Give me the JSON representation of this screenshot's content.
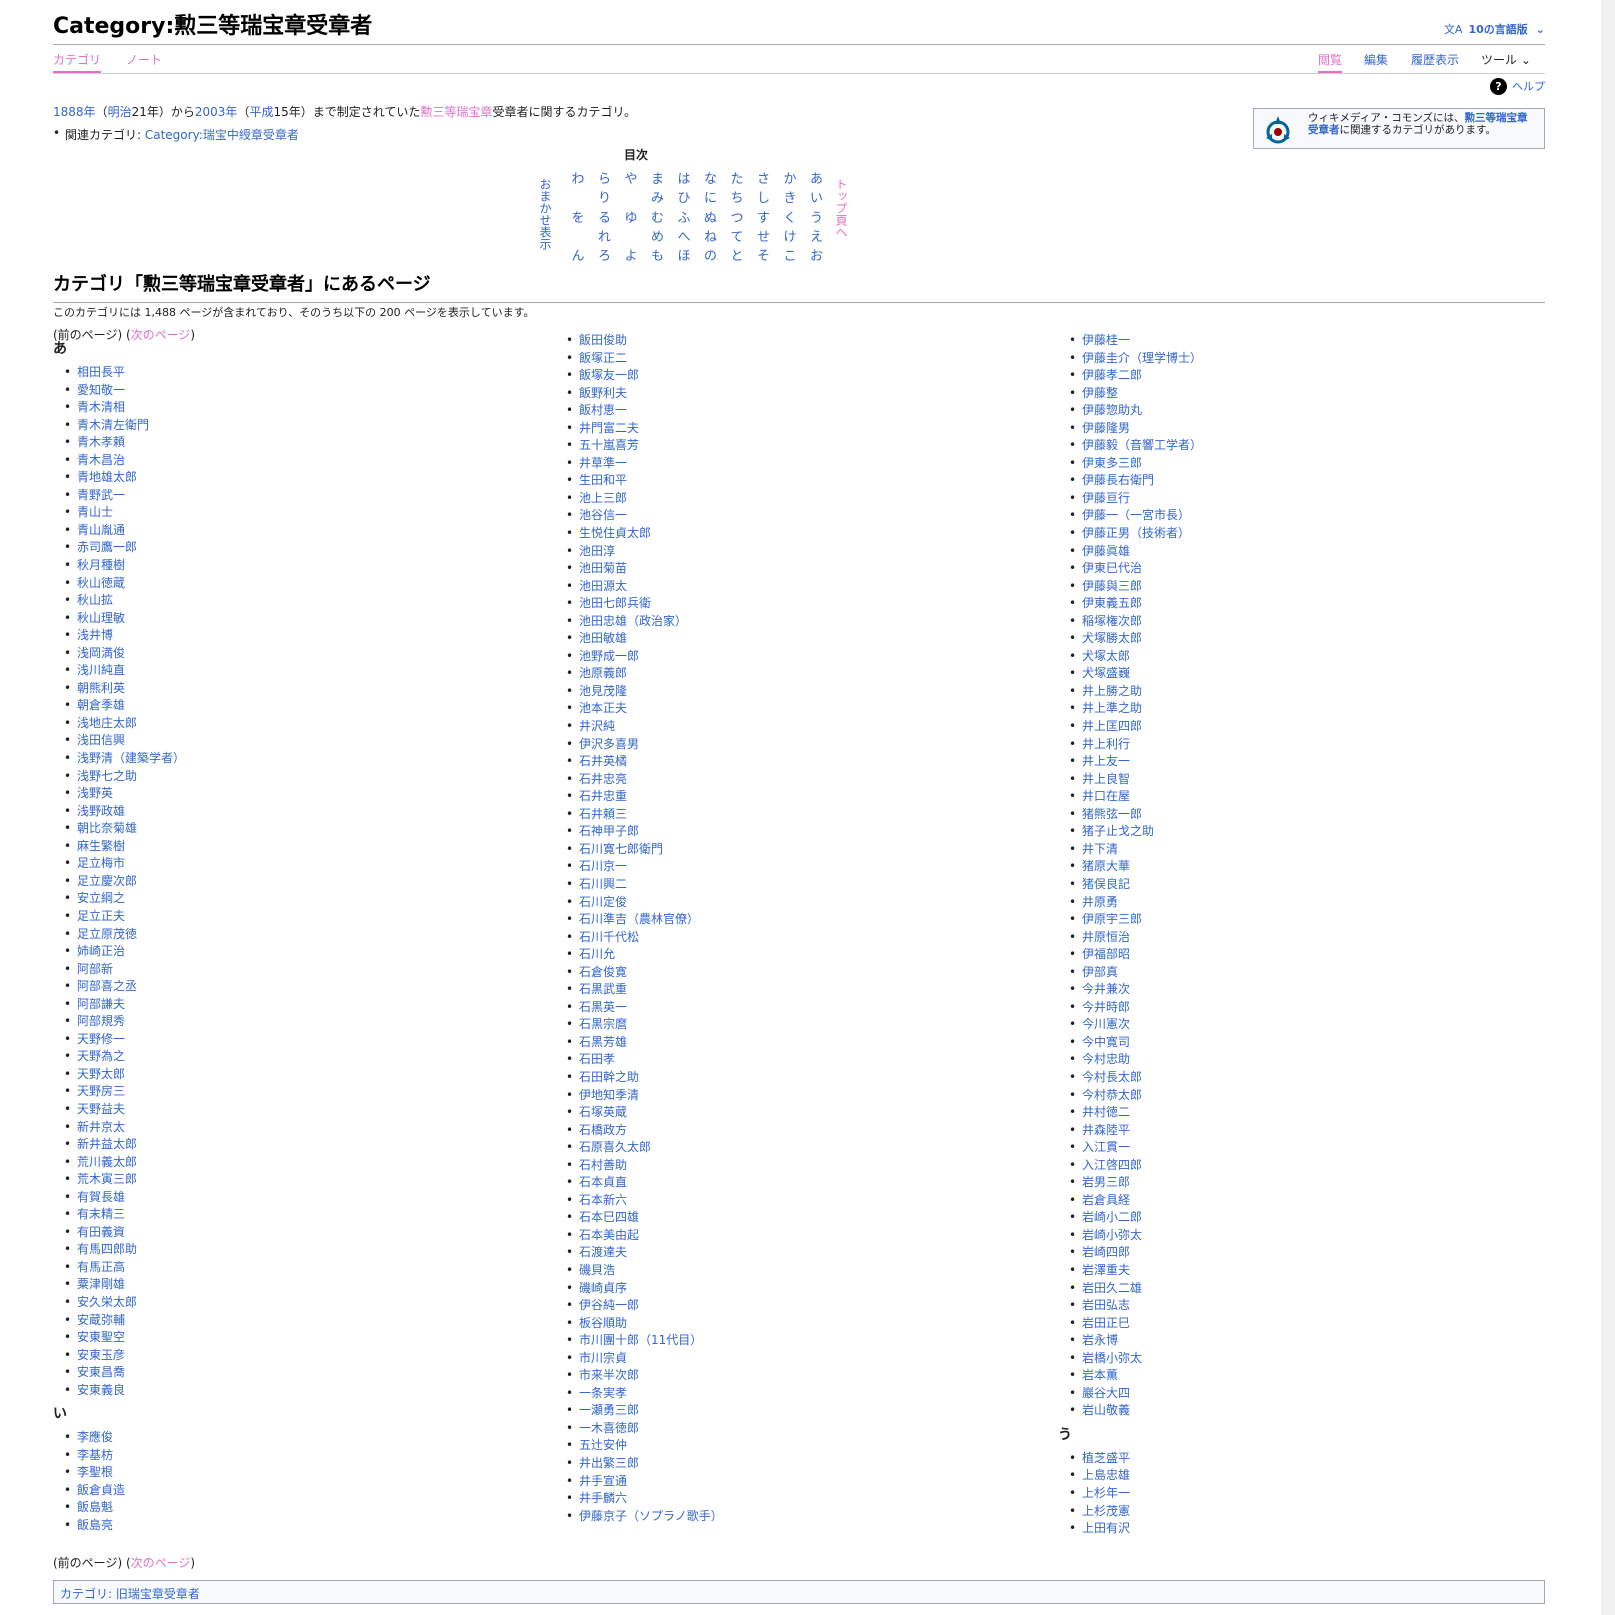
{
  "header": {
    "title": "Category:勲三等瑞宝章受章者",
    "lang_icon": "文A",
    "lang_label": "10の言語版",
    "tabs": {
      "category": "カテゴリ",
      "talk": "ノート",
      "read": "閲覧",
      "edit": "編集",
      "history": "履歴表示",
      "tools": "ツール"
    },
    "help": "ヘルプ"
  },
  "intro": {
    "year1": "1888年",
    "era1a": "明治",
    "era1b": "21年",
    "from": "から",
    "year2": "2003年",
    "era2a": "平成",
    "era2b": "15年",
    "mid": "まで制定されていた",
    "award": "勲三等瑞宝章",
    "tail": "受章者に関するカテゴリ。",
    "related_label": "関連カテゴリ: ",
    "related_link": "Category:瑞宝中綬章受章者",
    "open_paren": "（",
    "close_paren": "）"
  },
  "commons": {
    "pre": "ウィキメディア・コモンズには、",
    "link": "勲三等瑞宝章受章者",
    "post": "に関連するカテゴリがあります。"
  },
  "toc": {
    "title": "目次",
    "random": "おまかせ表示",
    "top": "トップ頁へ",
    "columns": [
      [
        "わ",
        "",
        "を",
        "",
        "ん"
      ],
      [
        "ら",
        "り",
        "る",
        "れ",
        "ろ"
      ],
      [
        "や",
        "",
        "ゆ",
        "",
        "よ"
      ],
      [
        "ま",
        "み",
        "む",
        "め",
        "も"
      ],
      [
        "は",
        "ひ",
        "ふ",
        "へ",
        "ほ"
      ],
      [
        "な",
        "に",
        "ぬ",
        "ね",
        "の"
      ],
      [
        "た",
        "ち",
        "つ",
        "て",
        "と"
      ],
      [
        "さ",
        "し",
        "す",
        "せ",
        "そ"
      ],
      [
        "か",
        "き",
        "く",
        "け",
        "こ"
      ],
      [
        "あ",
        "い",
        "う",
        "え",
        "お"
      ]
    ]
  },
  "section": {
    "heading": "カテゴリ「勲三等瑞宝章受章者」にあるページ",
    "count": "このカテゴリには 1,488 ページが含まれており、そのうち以下の 200 ページを表示しています。",
    "pager_prev": "(前のページ) (",
    "pager_next": "次のページ",
    "pager_end": ")"
  },
  "columns": [
    {
      "groups": [
        {
          "heading": "あ",
          "items": [
            "相田長平",
            "愛知敬一",
            "青木清相",
            "青木清左衛門",
            "青木孝頼",
            "青木昌治",
            "青地雄太郎",
            "青野武一",
            "青山士",
            "青山胤通",
            "赤司鷹一郎",
            "秋月種樹",
            "秋山徳蔵",
            "秋山拡",
            "秋山理敏",
            "浅井博",
            "浅岡満俊",
            "浅川純直",
            "朝熊利英",
            "朝倉季雄",
            "浅地庄太郎",
            "浅田信興",
            "浅野清（建築学者）",
            "浅野七之助",
            "浅野英",
            "浅野政雄",
            "朝比奈菊雄",
            "麻生繁樹",
            "足立梅市",
            "足立慶次郎",
            "安立綱之",
            "足立正夫",
            "足立原茂徳",
            "姉崎正治",
            "阿部新",
            "阿部喜之丞",
            "阿部謙夫",
            "阿部規秀",
            "天野修一",
            "天野為之",
            "天野太郎",
            "天野房三",
            "天野益夫",
            "新井京太",
            "新井益太郎",
            "荒川義太郎",
            "荒木寅三郎",
            "有賀長雄",
            "有末精三",
            "有田義資",
            "有馬四郎助",
            "有馬正高",
            "粟津剛雄",
            "安久栄太郎",
            "安蔵弥輔",
            "安東聖空",
            "安東玉彦",
            "安東昌喬",
            "安東義良"
          ]
        },
        {
          "heading": "い",
          "items": [
            "李應俊",
            "李基枋",
            "李聖根",
            "飯倉貞造",
            "飯島魁",
            "飯島亮"
          ]
        }
      ]
    },
    {
      "groups": [
        {
          "heading": "",
          "items": [
            "飯田俊助",
            "飯塚正二",
            "飯塚友一郎",
            "飯野利夫",
            "飯村恵一",
            "井門富二夫",
            "五十嵐喜芳",
            "井草準一",
            "生田和平",
            "池上三郎",
            "池谷信一",
            "生悦住貞太郎",
            "池田淳",
            "池田菊苗",
            "池田源太",
            "池田七郎兵衛",
            "池田忠雄（政治家）",
            "池田敏雄",
            "池野成一郎",
            "池原義郎",
            "池見茂隆",
            "池本正夫",
            "井沢純",
            "伊沢多喜男",
            "石井英橘",
            "石井忠亮",
            "石井忠重",
            "石井頼三",
            "石神甲子郎",
            "石川寛七郎衛門",
            "石川京一",
            "石川興二",
            "石川定俊",
            "石川準吉（農林官僚）",
            "石川千代松",
            "石川允",
            "石倉俊寛",
            "石黒武重",
            "石黒英一",
            "石黒宗麿",
            "石黒芳雄",
            "石田孝",
            "石田幹之助",
            "伊地知季清",
            "石塚英蔵",
            "石橋政方",
            "石原喜久太郎",
            "石村善助",
            "石本貞直",
            "石本新六",
            "石本巳四雄",
            "石本美由起",
            "石渡達夫",
            "磯貝浩",
            "磯崎貞序",
            "伊谷純一郎",
            "板谷順助",
            "市川團十郎（11代目）",
            "市川宗貞",
            "市来半次郎",
            "一条実孝",
            "一瀬勇三郎",
            "一木喜徳郎",
            "五辻安仲",
            "井出繁三郎",
            "井手宣通",
            "井手麟六",
            "伊藤京子（ソプラノ歌手）"
          ]
        }
      ]
    },
    {
      "groups": [
        {
          "heading": "",
          "items": [
            "伊藤桂一",
            "伊藤圭介（理学博士）",
            "伊藤孝二郎",
            "伊藤整",
            "伊藤惣助丸",
            "伊藤隆男",
            "伊藤毅（音響工学者）",
            "伊東多三郎",
            "伊藤長右衛門",
            "伊藤亘行",
            "伊藤一（一宮市長）",
            "伊藤正男（技術者）",
            "伊藤眞雄",
            "伊東巳代治",
            "伊藤與三郎",
            "伊東義五郎",
            "稲塚権次郎",
            "犬塚勝太郎",
            "犬塚太郎",
            "犬塚盛巍",
            "井上勝之助",
            "井上準之助",
            "井上匡四郎",
            "井上利行",
            "井上友一",
            "井上良智",
            "井口在屋",
            "猪熊弦一郎",
            "猪子止戈之助",
            "井下清",
            "猪原大華",
            "猪俣良記",
            "井原勇",
            "伊原宇三郎",
            "井原恒治",
            "伊福部昭",
            "伊部真",
            "今井兼次",
            "今井時郎",
            "今川憲次",
            "今中寛司",
            "今村忠助",
            "今村長太郎",
            "今村恭太郎",
            "井村徳二",
            "井森陸平",
            "入江貫一",
            "入江啓四郎",
            "岩男三郎",
            "岩倉具経",
            "岩崎小二郎",
            "岩崎小弥太",
            "岩崎四郎",
            "岩澤重夫",
            "岩田久二雄",
            "岩田弘志",
            "岩田正巳",
            "岩永博",
            "岩橋小弥太",
            "岩本薫",
            "巖谷大四",
            "岩山敬義"
          ]
        },
        {
          "heading": "う",
          "items": [
            "植芝盛平",
            "上島忠雄",
            "上杉年一",
            "上杉茂憲",
            "上田有沢"
          ]
        }
      ]
    }
  ],
  "catlinks": {
    "label": "カテゴリ: ",
    "link": "旧瑞宝章受章者"
  }
}
